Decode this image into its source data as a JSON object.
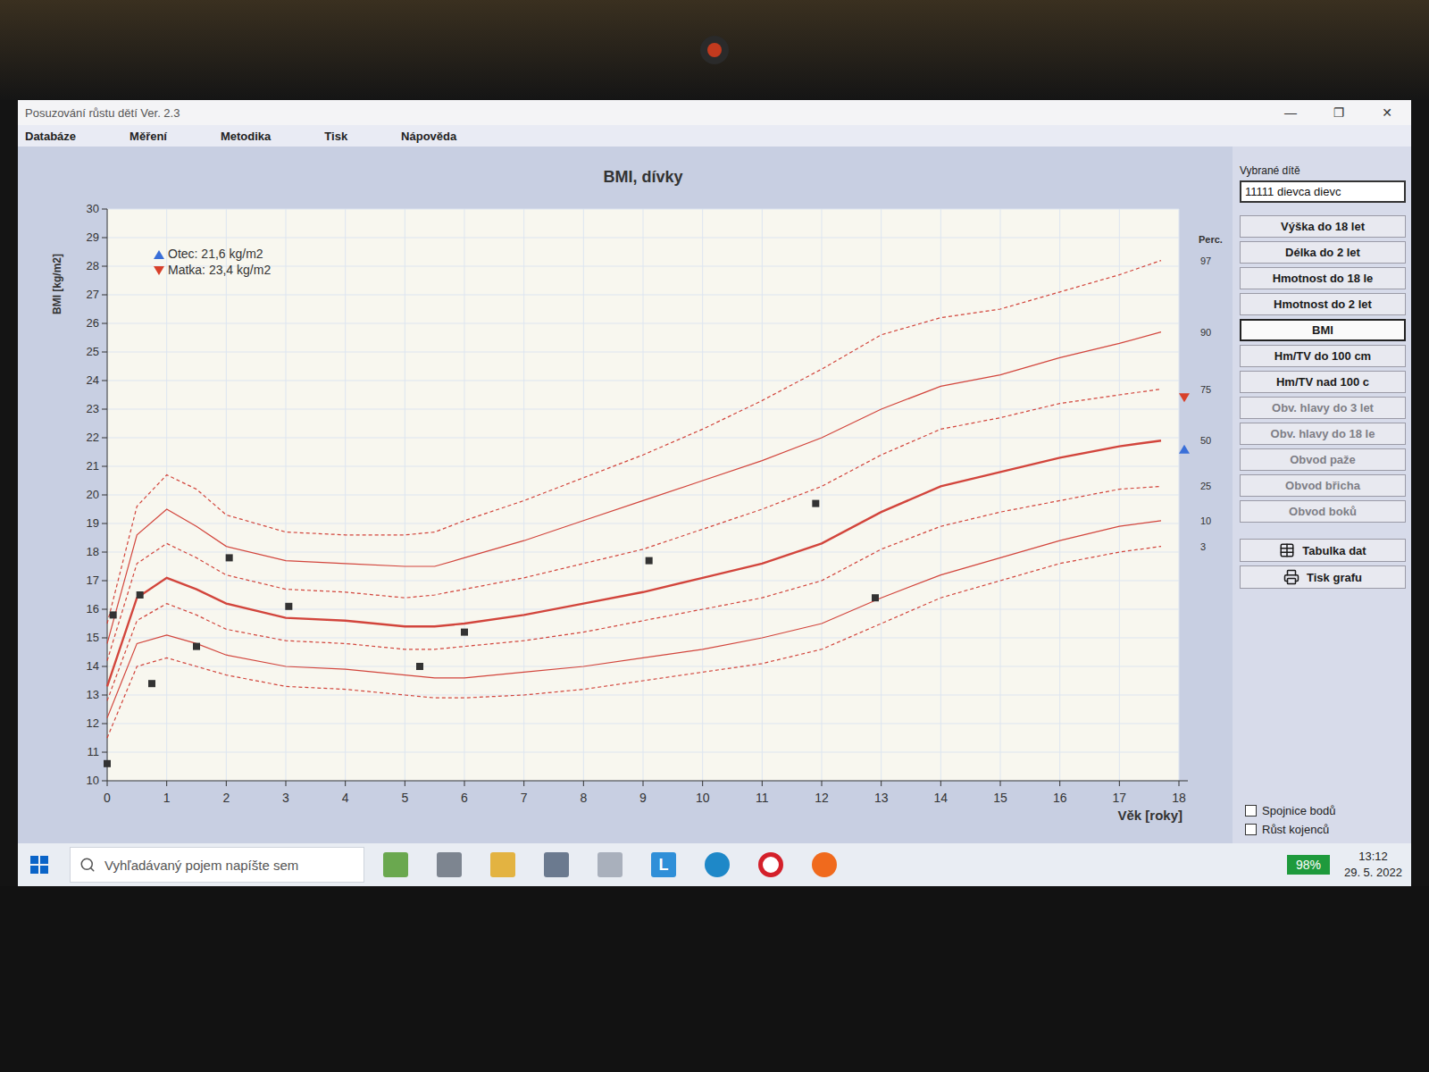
{
  "window": {
    "title": "Posuzování růstu dětí  Ver. 2.3",
    "controls": [
      "—",
      "❐",
      "✕"
    ]
  },
  "menu": [
    "Databáze",
    "Měření",
    "Metodika",
    "Tisk",
    "Nápověda"
  ],
  "chart": {
    "title": "BMI, dívky",
    "y_axis": {
      "label": "BMI [kg/m2]",
      "ticks": [
        "10",
        "11",
        "12",
        "13",
        "14",
        "15",
        "16",
        "17",
        "18",
        "19",
        "20",
        "21",
        "22",
        "23",
        "24",
        "25",
        "26",
        "27",
        "28",
        "29",
        "30"
      ]
    },
    "x_axis": {
      "label": "Věk [roky]",
      "ticks": [
        "0",
        "1",
        "2",
        "3",
        "4",
        "5",
        "6",
        "7",
        "8",
        "9",
        "10",
        "11",
        "12",
        "13",
        "14",
        "15",
        "16",
        "17",
        "18"
      ]
    },
    "legend": [
      {
        "label": "Otec: 21,6  kg/m2",
        "value": 21.6,
        "kind": "up",
        "color": "#3a6fd8"
      },
      {
        "label": "Matka: 23,4  kg/m2",
        "value": 23.4,
        "kind": "down",
        "color": "#d8402a"
      }
    ],
    "percentile_header": "Perc.",
    "ages": [
      0,
      0.5,
      1,
      1.5,
      2,
      3,
      4,
      5,
      5.5,
      6,
      7,
      8,
      9,
      10,
      11,
      12,
      13,
      14,
      15,
      16,
      17,
      17.7
    ],
    "percentiles": [
      {
        "label": "97",
        "kind": "dashed",
        "values": [
          15.5,
          19.6,
          20.7,
          20.2,
          19.3,
          18.7,
          18.6,
          18.6,
          18.7,
          19.1,
          19.8,
          20.6,
          21.4,
          22.3,
          23.3,
          24.4,
          25.6,
          26.2,
          26.5,
          27.1,
          27.7,
          28.2
        ]
      },
      {
        "label": "90",
        "kind": "solid",
        "values": [
          14.8,
          18.6,
          19.5,
          18.9,
          18.2,
          17.7,
          17.6,
          17.5,
          17.5,
          17.8,
          18.4,
          19.1,
          19.8,
          20.5,
          21.2,
          22.0,
          23.0,
          23.8,
          24.2,
          24.8,
          25.3,
          25.7
        ]
      },
      {
        "label": "75",
        "kind": "dashed",
        "values": [
          14.2,
          17.6,
          18.3,
          17.8,
          17.2,
          16.7,
          16.6,
          16.4,
          16.5,
          16.7,
          17.1,
          17.6,
          18.1,
          18.8,
          19.5,
          20.3,
          21.4,
          22.3,
          22.7,
          23.2,
          23.5,
          23.7
        ]
      },
      {
        "label": "50",
        "kind": "median",
        "values": [
          13.3,
          16.4,
          17.1,
          16.7,
          16.2,
          15.7,
          15.6,
          15.4,
          15.4,
          15.5,
          15.8,
          16.2,
          16.6,
          17.1,
          17.6,
          18.3,
          19.4,
          20.3,
          20.8,
          21.3,
          21.7,
          21.9
        ]
      },
      {
        "label": "25",
        "kind": "dashed",
        "values": [
          12.8,
          15.6,
          16.2,
          15.8,
          15.3,
          14.9,
          14.8,
          14.6,
          14.6,
          14.7,
          14.9,
          15.2,
          15.6,
          16.0,
          16.4,
          17.0,
          18.1,
          18.9,
          19.4,
          19.8,
          20.2,
          20.3
        ]
      },
      {
        "label": "10",
        "kind": "solid",
        "values": [
          12.2,
          14.8,
          15.1,
          14.8,
          14.4,
          14.0,
          13.9,
          13.7,
          13.6,
          13.6,
          13.8,
          14.0,
          14.3,
          14.6,
          15.0,
          15.5,
          16.4,
          17.2,
          17.8,
          18.4,
          18.9,
          19.1
        ]
      },
      {
        "label": "3",
        "kind": "dashed",
        "values": [
          11.5,
          14.0,
          14.3,
          14.0,
          13.7,
          13.3,
          13.2,
          13.0,
          12.9,
          12.9,
          13.0,
          13.2,
          13.5,
          13.8,
          14.1,
          14.6,
          15.5,
          16.4,
          17.0,
          17.6,
          18.0,
          18.2
        ]
      }
    ],
    "measurements": {
      "ages": [
        0,
        0.1,
        0.55,
        0.75,
        1.5,
        2.05,
        3.05,
        5.25,
        6.0,
        9.1,
        11.9,
        12.9
      ],
      "values": [
        10.6,
        15.8,
        16.5,
        13.4,
        14.7,
        17.8,
        16.1,
        14.0,
        15.2,
        17.7,
        19.7,
        16.4
      ]
    }
  },
  "sidebar": {
    "label": "Vybrané dítě",
    "child": "11111 dievca dievc",
    "buttons": [
      {
        "label": "Výška do 18 let",
        "selected": false,
        "disabled": false,
        "kind": "plain"
      },
      {
        "label": "Délka do 2 let",
        "selected": false,
        "disabled": false,
        "kind": "plain"
      },
      {
        "label": "Hmotnost do 18 le",
        "selected": false,
        "disabled": false,
        "kind": "plain"
      },
      {
        "label": "Hmotnost do 2 let",
        "selected": false,
        "disabled": false,
        "kind": "plain"
      },
      {
        "label": "BMI",
        "selected": true,
        "disabled": false,
        "kind": "plain"
      },
      {
        "label": "Hm/TV do 100 cm",
        "selected": false,
        "disabled": false,
        "kind": "plain"
      },
      {
        "label": "Hm/TV nad 100 c",
        "selected": false,
        "disabled": false,
        "kind": "plain"
      },
      {
        "label": "Obv. hlavy do 3 let",
        "selected": false,
        "disabled": true,
        "kind": "plain"
      },
      {
        "label": "Obv. hlavy do 18 le",
        "selected": false,
        "disabled": true,
        "kind": "plain"
      },
      {
        "label": "Obvod paže",
        "selected": false,
        "disabled": true,
        "kind": "plain"
      },
      {
        "label": "Obvod břicha",
        "selected": false,
        "disabled": true,
        "kind": "plain"
      },
      {
        "label": "Obvod boků",
        "selected": false,
        "disabled": true,
        "kind": "plain"
      },
      {
        "label": "Tabulka dat",
        "selected": false,
        "disabled": false,
        "kind": "table"
      },
      {
        "label": "Tisk grafu",
        "selected": false,
        "disabled": false,
        "kind": "print"
      }
    ],
    "checkboxes": [
      {
        "label": "Spojnice bodů",
        "checked": false
      },
      {
        "label": "Růst kojenců",
        "checked": false
      }
    ]
  },
  "taskbar": {
    "search_placeholder": "Vyhľadávaný pojem napíšte sem",
    "apps": [
      {
        "kind": "weather",
        "text": ""
      },
      {
        "kind": "task-view",
        "text": ""
      },
      {
        "kind": "explorer",
        "text": ""
      },
      {
        "kind": "calculator",
        "text": ""
      },
      {
        "kind": "growth-app",
        "text": ""
      },
      {
        "kind": "letter",
        "text": "L"
      },
      {
        "kind": "edge",
        "text": ""
      },
      {
        "kind": "opera",
        "text": ""
      },
      {
        "kind": "firefox",
        "text": ""
      }
    ],
    "battery": "98%",
    "time": "13:12",
    "date": "29. 5. 2022"
  }
}
